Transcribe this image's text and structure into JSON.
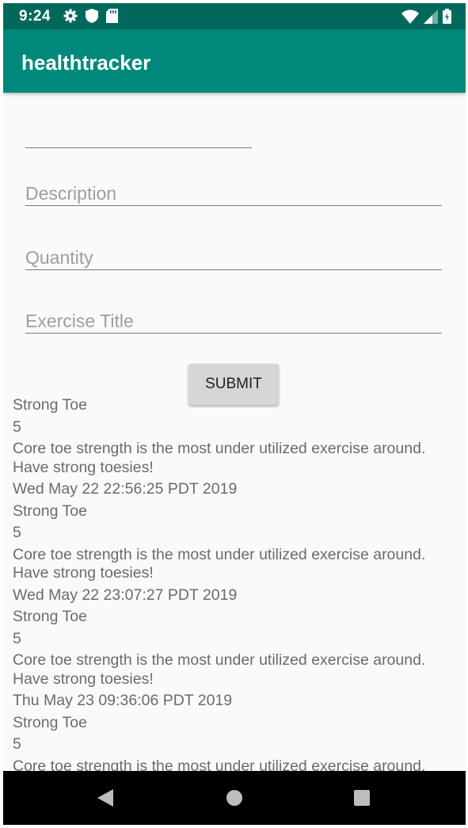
{
  "status_bar": {
    "time": "9:24",
    "left_icons": [
      "gear-icon",
      "shield-icon",
      "sd-card-icon"
    ],
    "right_icons": [
      "wifi-icon",
      "cell-signal-icon",
      "battery-icon"
    ]
  },
  "app_bar": {
    "title": "healthtracker"
  },
  "form": {
    "field_0_placeholder": "",
    "description_placeholder": "Description",
    "quantity_placeholder": "Quantity",
    "exercise_title_placeholder": "Exercise Title",
    "submit_label": "SUBMIT"
  },
  "entries": [
    {
      "title": "Strong Toe",
      "quantity": "5",
      "description": "Core toe strength is the most under utilized exercise around. Have strong toesies!",
      "timestamp": "Wed May 22 22:56:25 PDT 2019"
    },
    {
      "title": "Strong Toe",
      "quantity": "5",
      "description": "Core toe strength is the most under utilized exercise around. Have strong toesies!",
      "timestamp": "Wed May 22 23:07:27 PDT 2019"
    },
    {
      "title": "Strong Toe",
      "quantity": "5",
      "description": "Core toe strength is the most under utilized exercise around. Have strong toesies!",
      "timestamp": "Thu May 23 09:36:06 PDT 2019"
    },
    {
      "title": "Strong Toe",
      "quantity": "5",
      "description": "Core toe strength is the most under utilized exercise around.",
      "timestamp": ""
    }
  ],
  "nav_bar": {
    "icons": [
      "back-icon",
      "home-icon",
      "recents-icon"
    ]
  },
  "colors": {
    "status_bar": "#00695c",
    "app_bar": "#00897b",
    "button": "#d6d6d6"
  }
}
